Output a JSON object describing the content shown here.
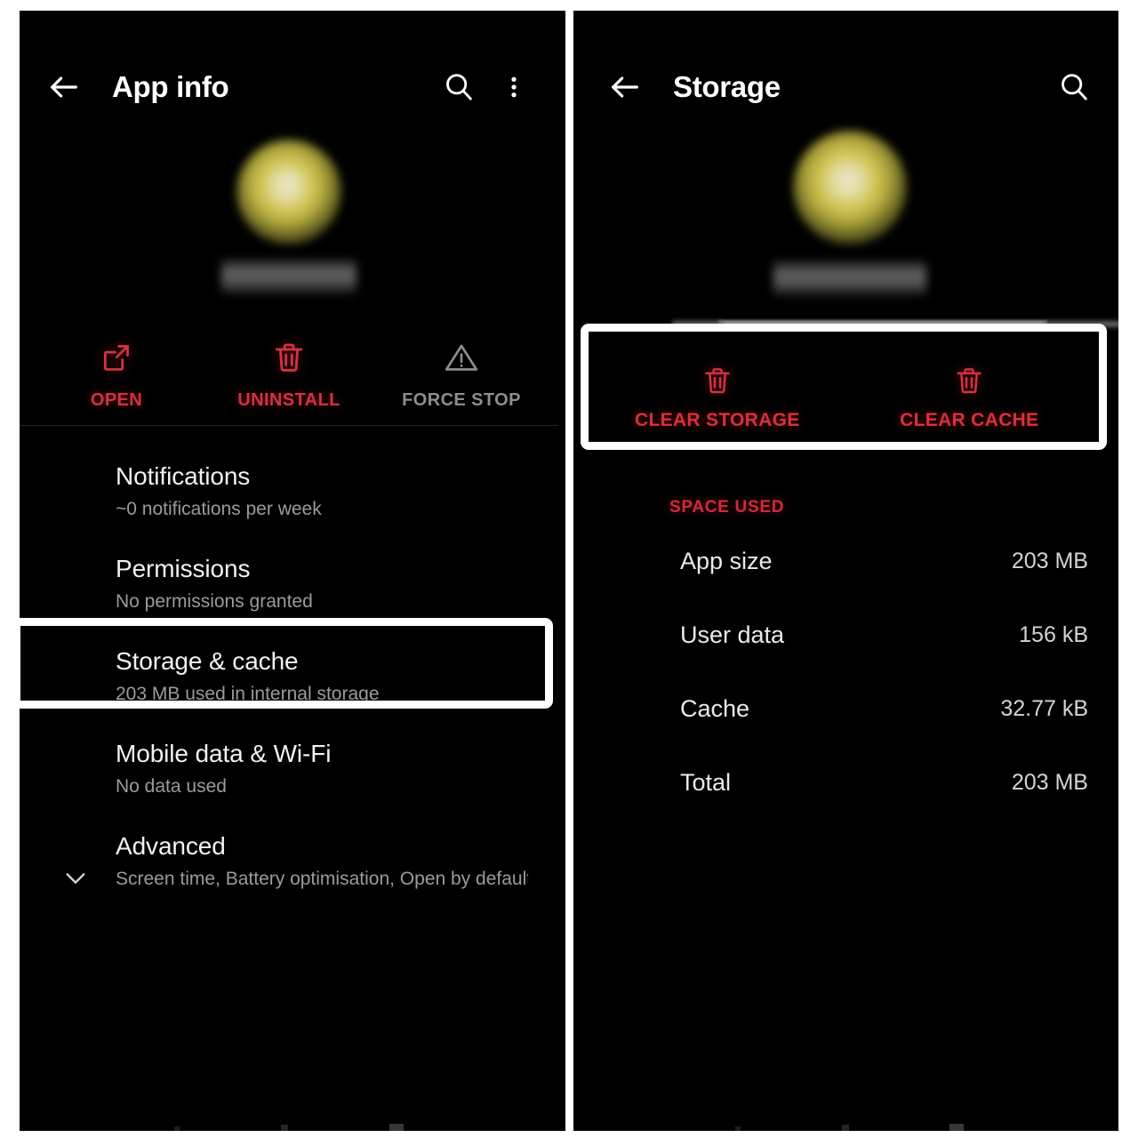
{
  "left_screen": {
    "appbar": {
      "title": "App info",
      "back_icon": "back-arrow-icon",
      "search_icon": "search-icon",
      "overflow_icon": "more-vertical-icon"
    },
    "app_header": {
      "icon": "blurred-app-icon",
      "name": "blurred-app-name"
    },
    "actions": [
      {
        "label": "OPEN",
        "icon": "open-external-icon",
        "state": "enabled"
      },
      {
        "label": "UNINSTALL",
        "icon": "trash-icon",
        "state": "enabled"
      },
      {
        "label": "FORCE STOP",
        "icon": "warning-triangle-icon",
        "state": "disabled"
      }
    ],
    "items": [
      {
        "title": "Notifications",
        "subtitle": "~0 notifications per week"
      },
      {
        "title": "Permissions",
        "subtitle": "No permissions granted"
      },
      {
        "title": "Storage & cache",
        "subtitle": "203 MB used in internal storage",
        "highlighted": true
      },
      {
        "title": "Mobile data & Wi-Fi",
        "subtitle": "No data used"
      },
      {
        "title": "Advanced",
        "subtitle": "Screen time, Battery optimisation, Open by default, St··",
        "expand_icon": "chevron-down-icon"
      }
    ]
  },
  "right_screen": {
    "appbar": {
      "title": "Storage",
      "back_icon": "back-arrow-icon",
      "search_icon": "search-icon"
    },
    "app_header": {
      "icon": "blurred-app-icon",
      "name": "blurred-app-name"
    },
    "clear_actions": [
      {
        "label": "CLEAR STORAGE",
        "icon": "trash-icon"
      },
      {
        "label": "CLEAR CACHE",
        "icon": "trash-icon"
      }
    ],
    "space_used": {
      "section_label": "SPACE USED",
      "rows": [
        {
          "key": "App size",
          "value": "203 MB"
        },
        {
          "key": "User data",
          "value": "156 kB"
        },
        {
          "key": "Cache",
          "value": "32.77 kB"
        },
        {
          "key": "Total",
          "value": "203 MB"
        }
      ]
    }
  },
  "colors": {
    "background": "#000000",
    "accent_red": "#d13341",
    "accent_red_bright": "#d5313f",
    "section_red": "#cf2b3a",
    "primary_text": "#f1f1f1",
    "secondary_text": "#9b9b9b",
    "disabled_text": "#8d8d8d",
    "highlight_outline": "#ffffff",
    "divider": "#242424"
  }
}
